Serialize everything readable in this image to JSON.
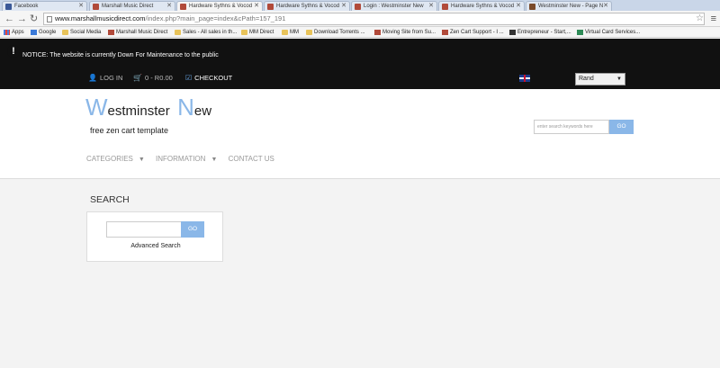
{
  "browser": {
    "tabs": [
      {
        "title": "Facebook",
        "favicon": "facebook-icon",
        "active": false
      },
      {
        "title": "Marshall Music Direct",
        "favicon": "zencart-icon",
        "active": false
      },
      {
        "title": "Hardware Sythns & Vocod",
        "favicon": "zencart-icon",
        "active": true
      },
      {
        "title": "Hardware Sythns & Vocod",
        "favicon": "zencart-icon",
        "active": false
      },
      {
        "title": "Login : Westminster New",
        "favicon": "zencart-icon",
        "active": false
      },
      {
        "title": "Hardware Sythns & Vocod",
        "favicon": "zencart-icon",
        "active": false
      },
      {
        "title": "Westminster New - Page N",
        "favicon": "monkey-icon",
        "active": false
      }
    ],
    "url_host": "www.marshallmusicdirect.com",
    "url_path": "/index.php?main_page=index&cPath=157_191",
    "bookmarks": [
      {
        "label": "Apps",
        "icon": "apps-grid-icon"
      },
      {
        "label": "Google",
        "icon": "google-icon"
      },
      {
        "label": "Social Media",
        "icon": "folder-icon"
      },
      {
        "label": "Marshall Music Direct",
        "icon": "zencart-icon"
      },
      {
        "label": "Sales - All sales in th...",
        "icon": "folder-icon"
      },
      {
        "label": "MM Direct",
        "icon": "folder-icon"
      },
      {
        "label": "MM",
        "icon": "folder-icon"
      },
      {
        "label": "Download Torrents ...",
        "icon": "shield-icon"
      },
      {
        "label": "Moving Site from Su...",
        "icon": "zencart-icon"
      },
      {
        "label": "Zen Cart Support - I ...",
        "icon": "zencart-icon"
      },
      {
        "label": "Entrepreneur - Start,...",
        "icon": "entrepreneur-icon"
      },
      {
        "label": "Virtual Card Services...",
        "icon": "v-icon"
      }
    ]
  },
  "notice": {
    "text": "NOTICE: The website is currently Down For Maintenance to the public"
  },
  "topnav": {
    "login": "LOG IN",
    "cart": "0 - R0.00",
    "checkout": "CHECKOUT",
    "currency": "Rand"
  },
  "header": {
    "logo_w": "W",
    "logo_rest1": "estminster",
    "logo_n": "N",
    "logo_rest2": "ew",
    "tagline": "free zen cart template",
    "search_placeholder": "enter search keywords here",
    "search_go": "GO",
    "nav": {
      "categories": "CATEGORIES",
      "information": "INFORMATION",
      "contact": "CONTACT US"
    }
  },
  "main": {
    "title": "SEARCH",
    "go": "GO",
    "advanced": "Advanced Search"
  },
  "colors": {
    "accent": "#8ab7e8",
    "dark_bar": "#111111",
    "page_bg": "#f3f3f3"
  }
}
